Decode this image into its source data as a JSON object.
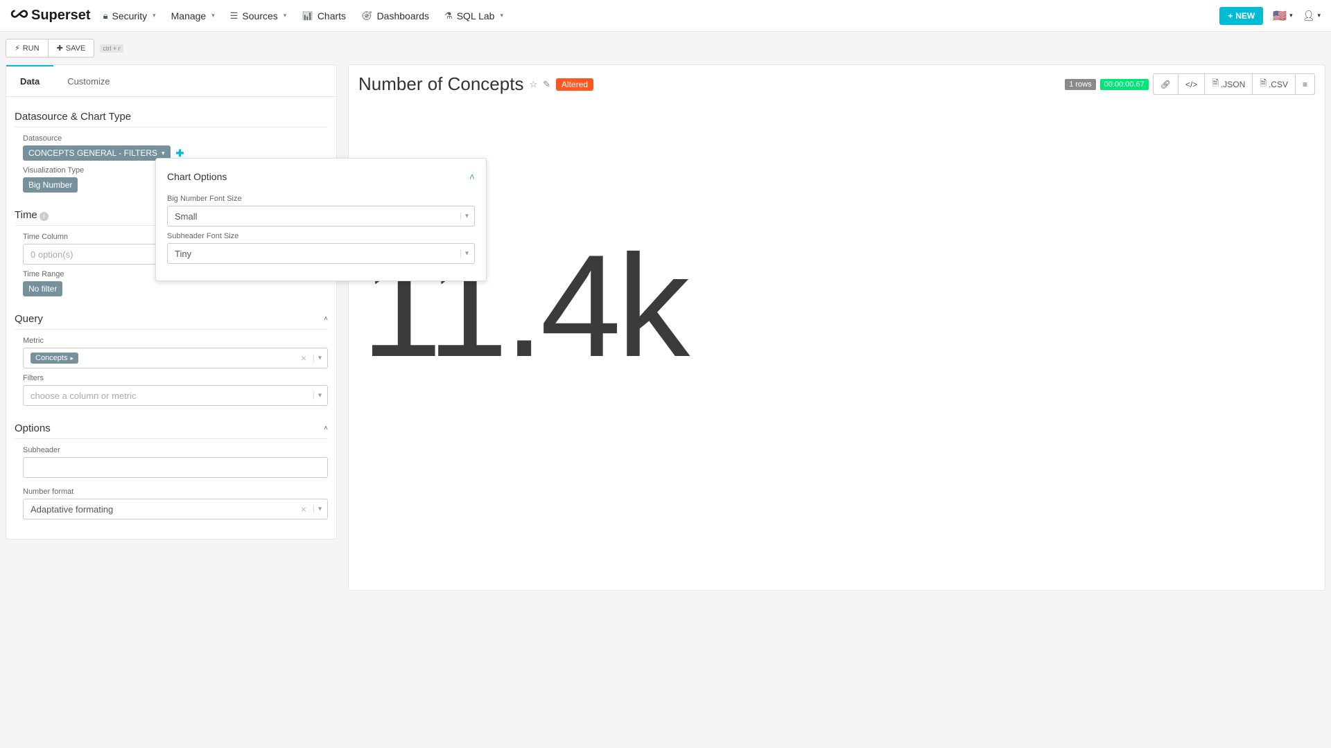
{
  "brand": "Superset",
  "nav": {
    "security": "Security",
    "manage": "Manage",
    "sources": "Sources",
    "charts": "Charts",
    "dashboards": "Dashboards",
    "sqllab": "SQL Lab",
    "new": "NEW"
  },
  "actions": {
    "run": "RUN",
    "save": "SAVE",
    "kbd": "ctrl + r"
  },
  "tabs": {
    "data": "Data",
    "customize": "Customize"
  },
  "dsSection": {
    "title": "Datasource & Chart Type",
    "datasourceLabel": "Datasource",
    "datasource": "CONCEPTS GENERAL - FILTERS",
    "vizLabel": "Visualization Type",
    "viz": "Big Number"
  },
  "timeSection": {
    "title": "Time",
    "timeColLabel": "Time Column",
    "timeColValue": "0 option(s)",
    "timeRangeLabel": "Time Range",
    "timeRangeValue": "No filter"
  },
  "querySection": {
    "title": "Query",
    "metricLabel": "Metric",
    "metricValue": "Concepts",
    "filtersLabel": "Filters",
    "filtersPlaceholder": "choose a column or metric"
  },
  "optionsSection": {
    "title": "Options",
    "subheaderLabel": "Subheader",
    "subheaderValue": "",
    "numfmtLabel": "Number format",
    "numfmtValue": "Adaptative formating"
  },
  "popover": {
    "title": "Chart Options",
    "bigFontLabel": "Big Number Font Size",
    "bigFontValue": "Small",
    "subFontLabel": "Subheader Font Size",
    "subFontValue": "Tiny"
  },
  "chart": {
    "title": "Number of Concepts",
    "altered": "Altered",
    "rows": "1 rows",
    "timer": "00:00:00.67",
    "json": ".JSON",
    "csv": ".CSV",
    "bigNumber": "11.4k"
  }
}
